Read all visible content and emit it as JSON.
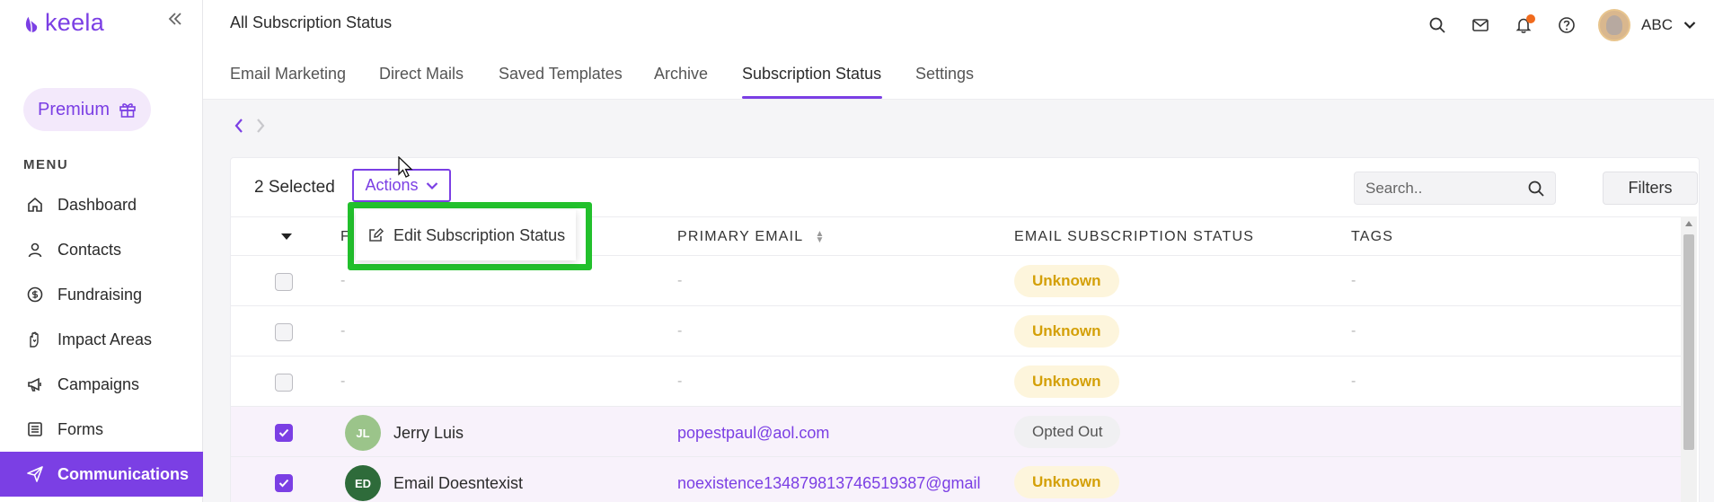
{
  "brand": {
    "name": "keela"
  },
  "sidebar": {
    "premium_label": "Premium",
    "menu_heading": "MENU",
    "items": [
      {
        "label": "Dashboard",
        "icon": "home-icon"
      },
      {
        "label": "Contacts",
        "icon": "user-icon"
      },
      {
        "label": "Fundraising",
        "icon": "coin-icon"
      },
      {
        "label": "Impact Areas",
        "icon": "hand-heart-icon"
      },
      {
        "label": "Campaigns",
        "icon": "megaphone-icon"
      },
      {
        "label": "Forms",
        "icon": "form-icon"
      },
      {
        "label": "Communications",
        "icon": "send-icon",
        "active": true
      }
    ]
  },
  "header": {
    "title": "All Subscription Status",
    "user_name": "ABC"
  },
  "tabs": [
    {
      "label": "Email Marketing"
    },
    {
      "label": "Direct Mails"
    },
    {
      "label": "Saved Templates"
    },
    {
      "label": "Archive"
    },
    {
      "label": "Subscription Status",
      "active": true
    },
    {
      "label": "Settings"
    }
  ],
  "toolbar": {
    "selected_count": "2 Selected",
    "actions_label": "Actions",
    "search_placeholder": "Search..",
    "filters_label": "Filters"
  },
  "dropdown": {
    "items": [
      {
        "label": "Edit Subscription Status",
        "icon": "edit-icon"
      }
    ]
  },
  "table": {
    "columns": {
      "name": "F",
      "email": "PRIMARY EMAIL",
      "status": "EMAIL SUBSCRIPTION STATUS",
      "tags": "TAGS"
    },
    "rows": [
      {
        "checked": false,
        "initials": "",
        "name": "-",
        "email": "-",
        "status": "Unknown",
        "tags": "-"
      },
      {
        "checked": false,
        "initials": "",
        "name": "-",
        "email": "-",
        "status": "Unknown",
        "tags": "-"
      },
      {
        "checked": false,
        "initials": "",
        "name": "-",
        "email": "-",
        "status": "Unknown",
        "tags": "-"
      },
      {
        "checked": true,
        "initials": "JL",
        "avatar_color": "#9bc48a",
        "name": "Jerry Luis",
        "email": "popestpaul@aol.com",
        "status": "Opted Out",
        "tags": ""
      },
      {
        "checked": true,
        "initials": "ED",
        "avatar_color": "#2e6b3a",
        "name": "Email Doesntexist",
        "email": "noexistence134879813746519387@gmail",
        "status": "Unknown",
        "tags": ""
      }
    ]
  },
  "colors": {
    "accent": "#7b3fe4",
    "highlight": "#22c02c",
    "unknown": "#d4a008"
  }
}
